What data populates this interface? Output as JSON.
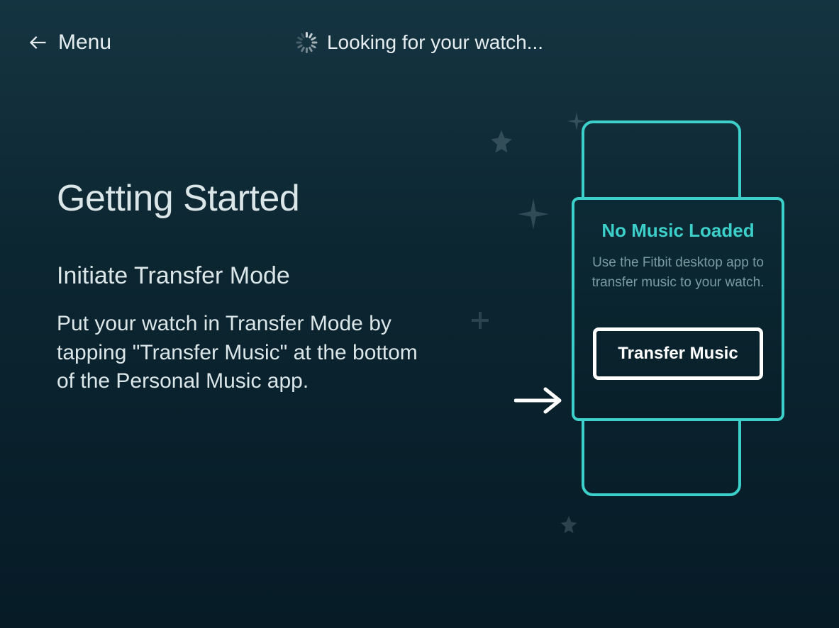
{
  "header": {
    "menu_label": "Menu",
    "status_text": "Looking for your watch..."
  },
  "main": {
    "heading": "Getting Started",
    "subheading": "Initiate Transfer Mode",
    "body": "Put your watch in Transfer Mode by tapping \"Transfer Music\" at the bottom of the Personal Music app."
  },
  "watch": {
    "title": "No Music Loaded",
    "body": "Use the Fitbit desktop app to transfer music to your watch.",
    "button": "Transfer Music"
  }
}
